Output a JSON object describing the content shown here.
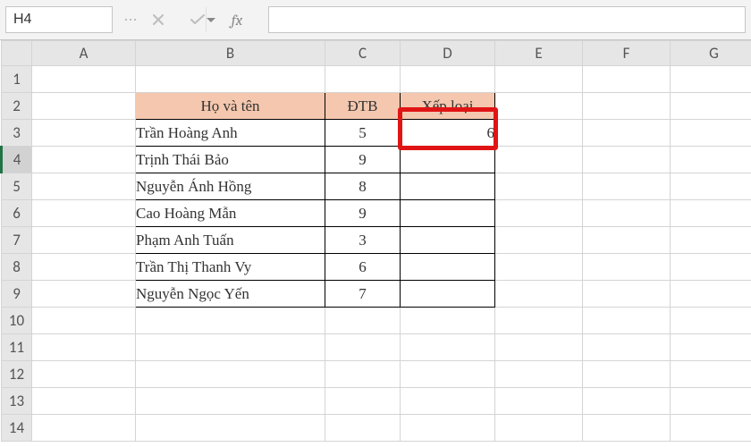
{
  "namebox": {
    "value": "H4"
  },
  "formula": {
    "value": ""
  },
  "columns": [
    "A",
    "B",
    "C",
    "D",
    "E",
    "F",
    "G"
  ],
  "rowcount": 14,
  "selected_row": 4,
  "headers": {
    "b2": "Họ và tên",
    "c2": "ĐTB",
    "d2": "Xếp loại"
  },
  "rows": [
    {
      "name": "Trần Hoàng Anh",
      "dtb": "5",
      "xl": "6"
    },
    {
      "name": "Trịnh Thái Bảo",
      "dtb": "9",
      "xl": ""
    },
    {
      "name": "Nguyễn Ánh Hồng",
      "dtb": "8",
      "xl": ""
    },
    {
      "name": "Cao Hoàng Mẫn",
      "dtb": "9",
      "xl": ""
    },
    {
      "name": "Phạm Anh Tuấn",
      "dtb": "3",
      "xl": ""
    },
    {
      "name": "Trần Thị Thanh Vy",
      "dtb": "6",
      "xl": ""
    },
    {
      "name": "Nguyễn Ngọc Yến",
      "dtb": "7",
      "xl": ""
    }
  ],
  "icons": {
    "cancel": "✕",
    "enter": "✓",
    "fx": "fx"
  },
  "highlight": {
    "cell": "D3"
  }
}
